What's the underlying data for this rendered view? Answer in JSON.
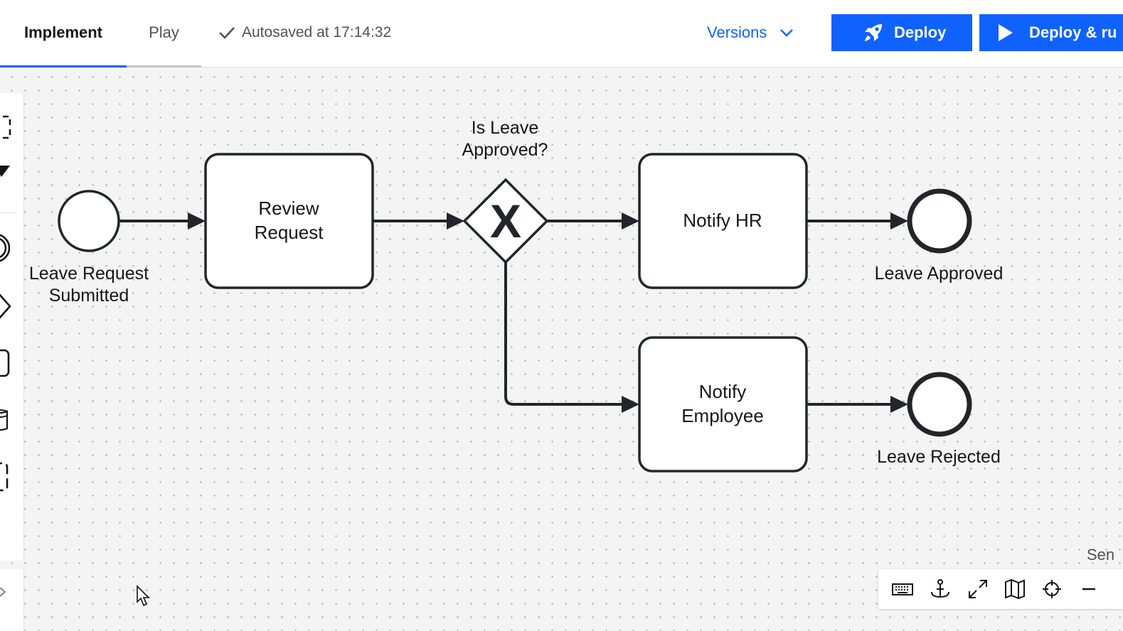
{
  "header": {
    "tabs": [
      {
        "label": "Implement",
        "active": true
      },
      {
        "label": "Play",
        "active": false
      }
    ],
    "autosave_text": "Autosaved at 17:14:32",
    "versions_label": "Versions",
    "deploy_label": "Deploy",
    "deploy_run_label": "Deploy & ru"
  },
  "diagram": {
    "start_event_label_1": "Leave Request",
    "start_event_label_2": "Submitted",
    "review_task_line_1": "Review",
    "review_task_line_2": "Request",
    "gateway_label_1": "Is Leave",
    "gateway_label_2": "Approved?",
    "gateway_marker": "X",
    "notify_hr_label": "Notify HR",
    "notify_employee_line_1": "Notify",
    "notify_employee_line_2": "Employee",
    "end_approved_label": "Leave Approved",
    "end_rejected_label": "Leave Rejected"
  },
  "canvas": {
    "partial_text": "Sen"
  },
  "toolbar": {
    "icons": [
      "keyboard-icon",
      "anchor-icon",
      "fullscreen-icon",
      "minimap-icon",
      "crosshair-icon",
      "zoom-out-icon"
    ]
  },
  "colors": {
    "accent": "#0f62fe",
    "stroke": "#22262b",
    "canvas_bg": "#f4f4f4"
  }
}
